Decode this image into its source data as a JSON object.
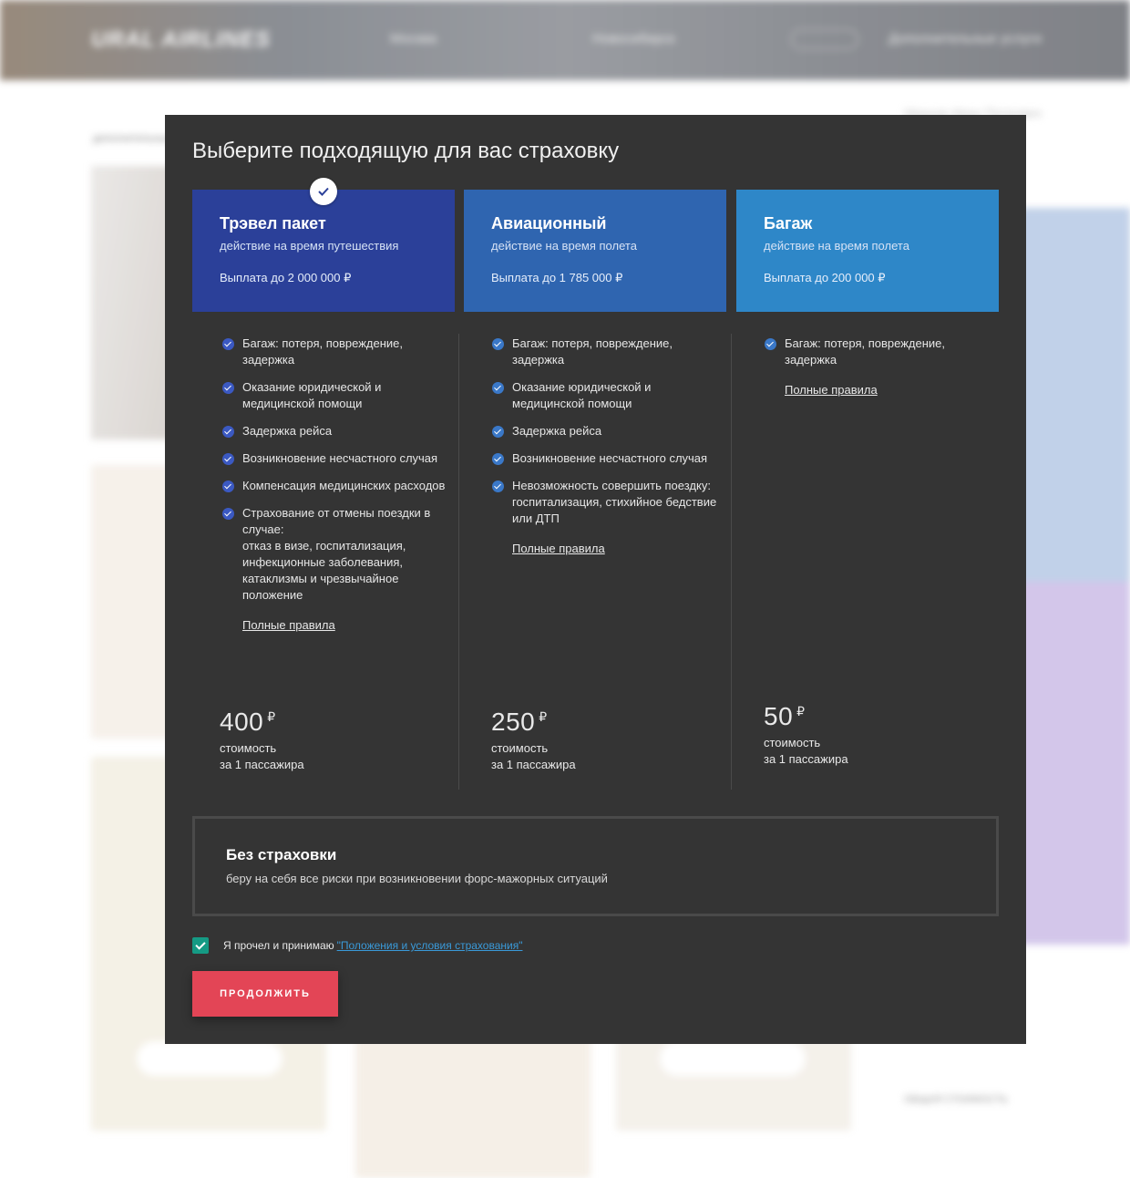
{
  "background": {
    "logo": "URAL AIRLINES",
    "nav": [
      "Москва",
      "Новосибирск",
      "Дополнительные услуги"
    ],
    "user": "Иванов Иван Петрович",
    "breadcrumb": "дополнительные услуги",
    "total_label": "ОБЩАЯ СТОИМОСТЬ"
  },
  "modal": {
    "title": "Выберите подходящую для вас страховку",
    "rules_link": "Полные правила",
    "price_caption": "стоимость\nза 1 пассажира",
    "currency": "₽",
    "plans": [
      {
        "name": "Трэвел пакет",
        "subtitle": "действие на время путешествия",
        "payout": "Выплата до 2 000 000 ₽",
        "selected": true,
        "features": [
          "Багаж: потеря, повреждение, задержка",
          "Оказание юридической и медицинской помощи",
          "Задержка рейса",
          "Возникновение несчастного случая",
          "Компенсация медицинских расходов",
          "Страхование от отмены поездки в случае:\nотказ в визе, госпитализация, инфекционные заболевания, катаклизмы и чрезвычайное положение"
        ],
        "price": "400"
      },
      {
        "name": "Авиационный",
        "subtitle": "действие на время полета",
        "payout": "Выплата до 1 785 000 ₽",
        "selected": false,
        "features": [
          "Багаж: потеря, повреждение, задержка",
          "Оказание юридической и медицинской помощи",
          "Задержка рейса",
          "Возникновение несчастного случая",
          "Невозможность совершить поездку: госпитализация, стихийное бедствие или ДТП"
        ],
        "price": "250"
      },
      {
        "name": "Багаж",
        "subtitle": "действие на время полета",
        "payout": "Выплата до 200 000 ₽",
        "selected": false,
        "features": [
          "Багаж: потеря, повреждение, задержка"
        ],
        "price": "50"
      }
    ],
    "no_insurance": {
      "title": "Без страховки",
      "subtitle": "беру на себя все риски при возникновении форс-мажорных ситуаций"
    },
    "agreement": {
      "checked": true,
      "text": "Я прочел и принимаю",
      "link": "\"Положения и условия страхования\""
    },
    "continue_label": "ПРОДОЛЖИТЬ"
  },
  "colors": {
    "modal_bg": "#343434",
    "plan_travel": "#2b4099",
    "plan_avia": "#2f65b0",
    "plan_baggage": "#2e87c8",
    "accent_button": "#e34556",
    "checkbox": "#159a84",
    "link": "#3a9ad9"
  }
}
